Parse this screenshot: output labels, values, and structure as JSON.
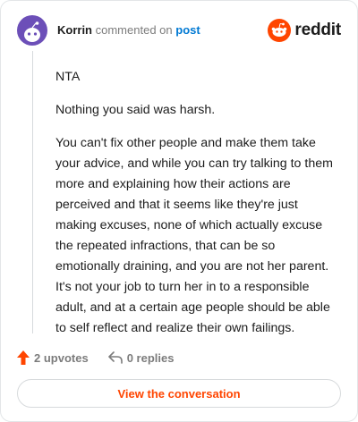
{
  "header": {
    "author": "Korrin",
    "action_text": "commented on",
    "post_link": "post",
    "logo_text": "reddit"
  },
  "icons": {
    "avatar": "snoo-avatar-icon",
    "logo": "reddit-snoo-icon",
    "upvote": "upvote-arrow-icon",
    "reply": "reply-arrow-icon"
  },
  "colors": {
    "brand": "#ff4500",
    "link": "#0079d3",
    "avatar_bg": "#6c4fb8"
  },
  "comment": {
    "paragraphs": [
      "NTA",
      "Nothing you said was harsh.",
      "You can't fix other people and make them take your advice, and while you can try talking to them more and explaining how their actions are perceived and that it seems like they're just making excuses, none of which actually excuse the repeated infractions, that can be so emotionally draining, and you are not her parent. It's not your job to turn her in to a responsible adult, and at a certain age people should be able to self reflect and realize their own failings."
    ]
  },
  "actions": {
    "upvotes": "2 upvotes",
    "replies": "0 replies"
  },
  "cta": {
    "label": "View the conversation"
  }
}
